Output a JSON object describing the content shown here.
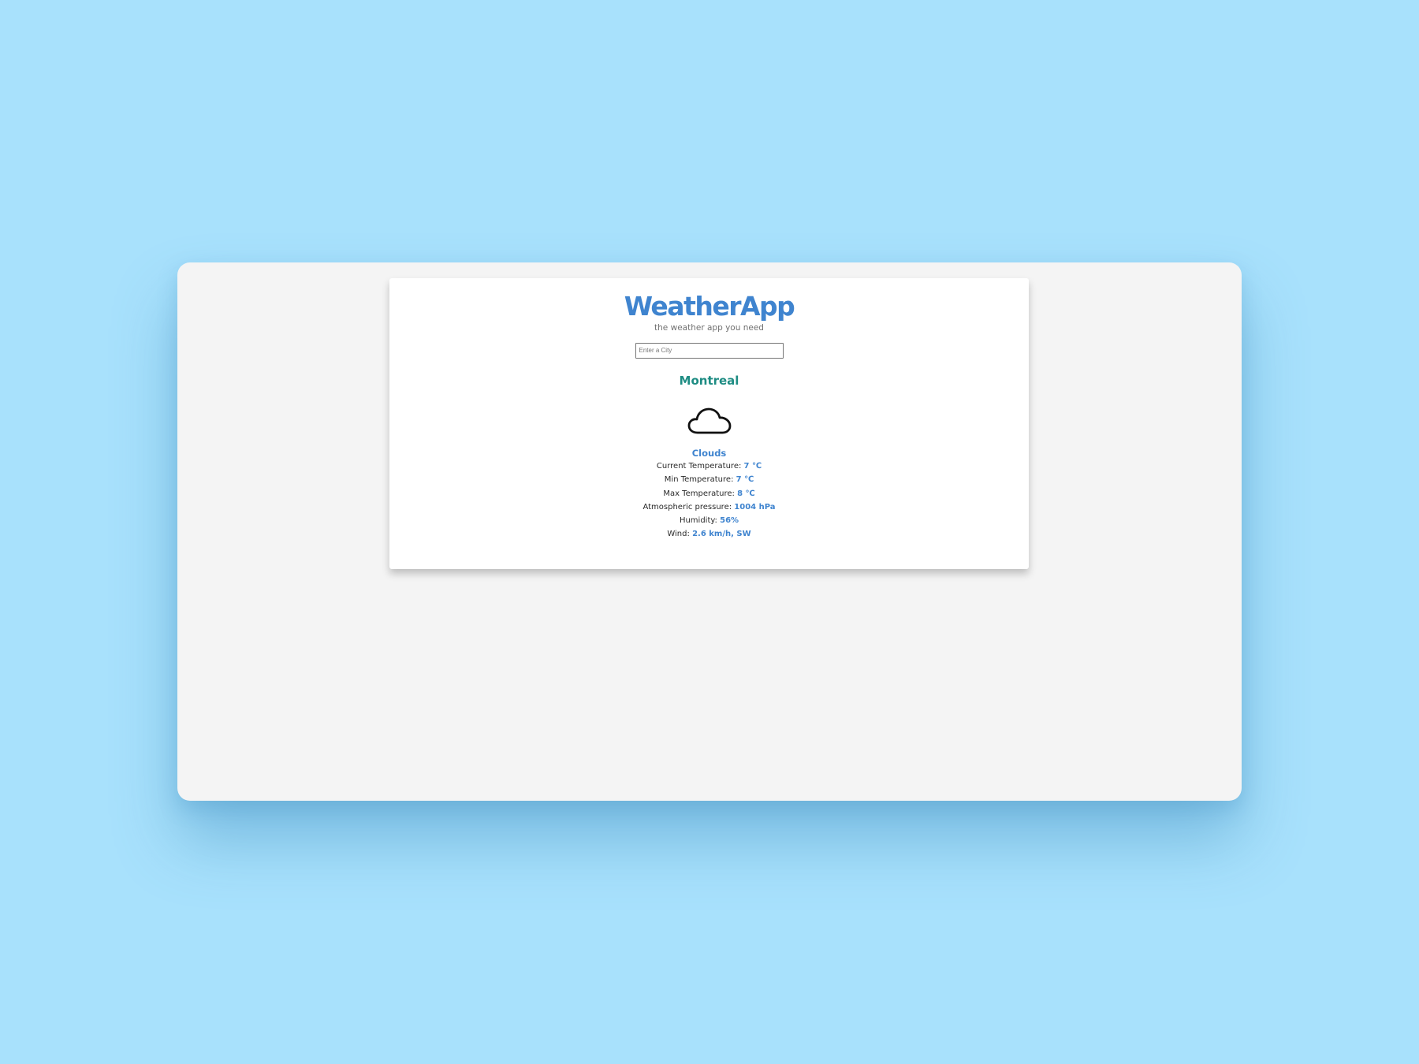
{
  "app": {
    "title": "WeatherApp",
    "tagline": "the weather app you need"
  },
  "search": {
    "placeholder": "Enter a City",
    "value": ""
  },
  "weather": {
    "city": "Montreal",
    "icon": "cloud-icon",
    "condition": "Clouds",
    "stats": [
      {
        "label": "Current Temperature:",
        "value": "7 ℃"
      },
      {
        "label": "Min Temperature:",
        "value": "7 ℃"
      },
      {
        "label": "Max Temperature:",
        "value": "8 ℃"
      },
      {
        "label": "Atmospheric pressure:",
        "value": "1004 hPa"
      },
      {
        "label": "Humidity:",
        "value": "56%"
      },
      {
        "label": "Wind:",
        "value": "2.6 km/h, SW"
      }
    ]
  },
  "colors": {
    "page_background": "#a8e1fc",
    "window_background": "#f4f4f4",
    "card_background": "#ffffff",
    "accent_blue": "#3f84cf",
    "city_teal": "#1e8c83"
  }
}
